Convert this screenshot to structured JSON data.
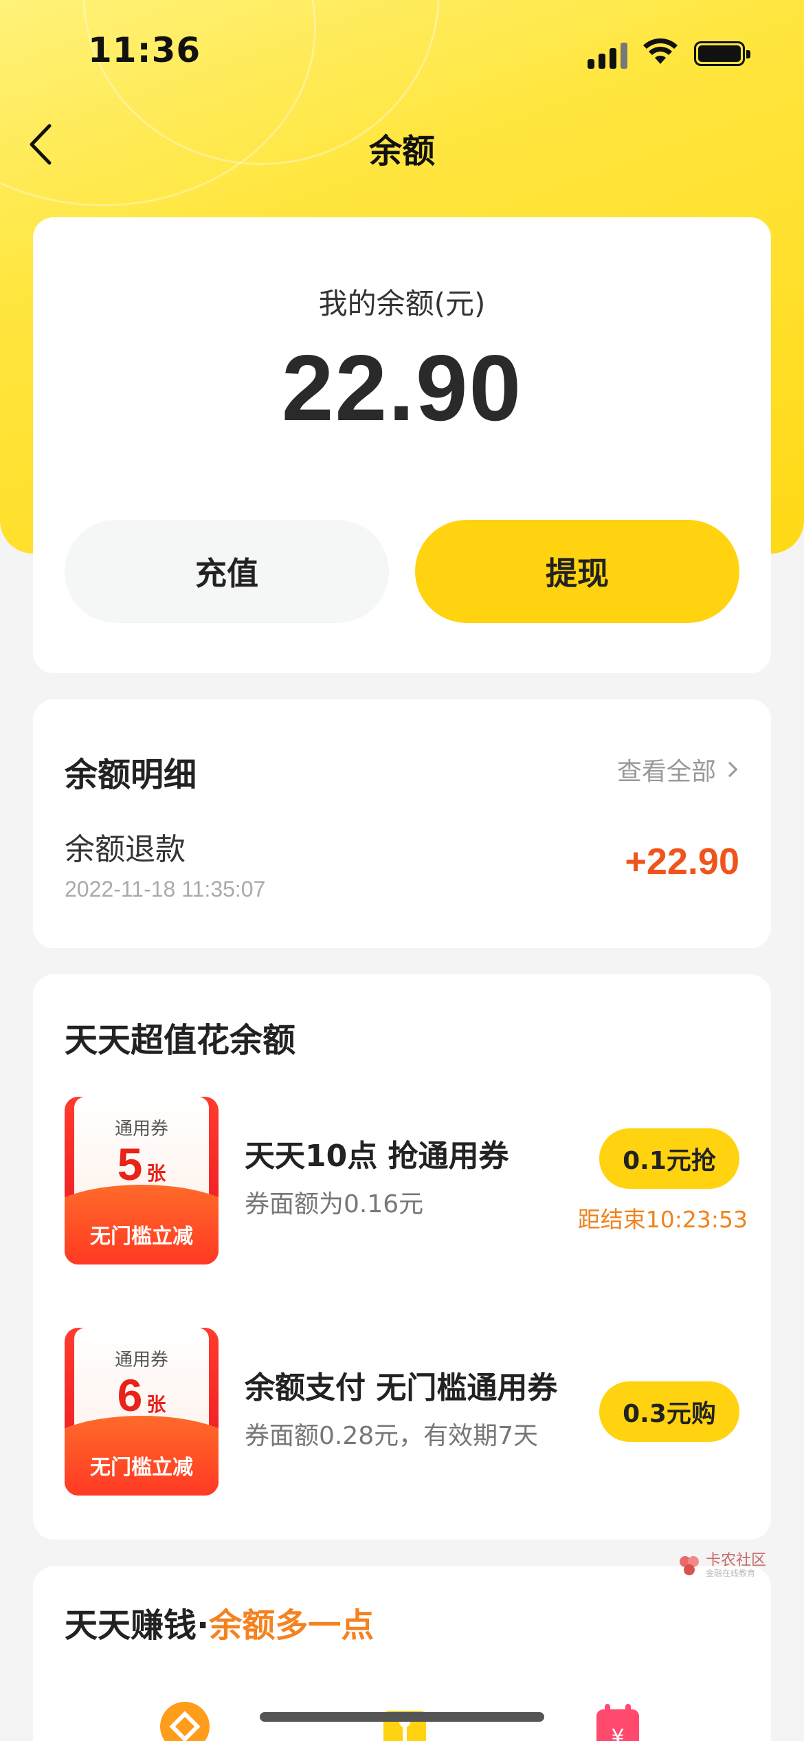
{
  "status_bar": {
    "time": "11:36"
  },
  "nav": {
    "title": "余额"
  },
  "balance": {
    "label": "我的余额(元)",
    "amount": "22.90",
    "recharge_label": "充值",
    "withdraw_label": "提现"
  },
  "details": {
    "title": "余额明细",
    "view_all": "查看全部",
    "transactions": [
      {
        "name": "余额退款",
        "time": "2022-11-18 11:35:07",
        "amount": "+22.90"
      }
    ]
  },
  "deals": {
    "title": "天天超值花余额",
    "items": [
      {
        "coupon_top": "通用券",
        "coupon_count": "5",
        "coupon_unit": "张",
        "coupon_bottom": "无门槛立减",
        "title": "天天10点 抢通用券",
        "subtitle": "券面额为0.16元",
        "button": "0.1元抢",
        "countdown": "距结束10:23:53"
      },
      {
        "coupon_top": "通用券",
        "coupon_count": "6",
        "coupon_unit": "张",
        "coupon_bottom": "无门槛立减",
        "title": "余额支付 无门槛通用券",
        "subtitle": "券面额0.28元，有效期7天",
        "button": "0.3元购"
      }
    ]
  },
  "earn": {
    "title_part1": "天天赚钱·",
    "title_part2": "余额多一点",
    "icons": [
      "coin-icon",
      "gift-icon",
      "calendar-icon"
    ]
  },
  "watermark": {
    "line1": "卡农社区",
    "line2": "金融在线教育"
  },
  "colors": {
    "header_yellow": "#ffd916",
    "button_yellow": "#ffd30f",
    "amount_orange": "#f0541c",
    "countdown_orange": "#f0821c",
    "coupon_red": "#e8141f"
  }
}
